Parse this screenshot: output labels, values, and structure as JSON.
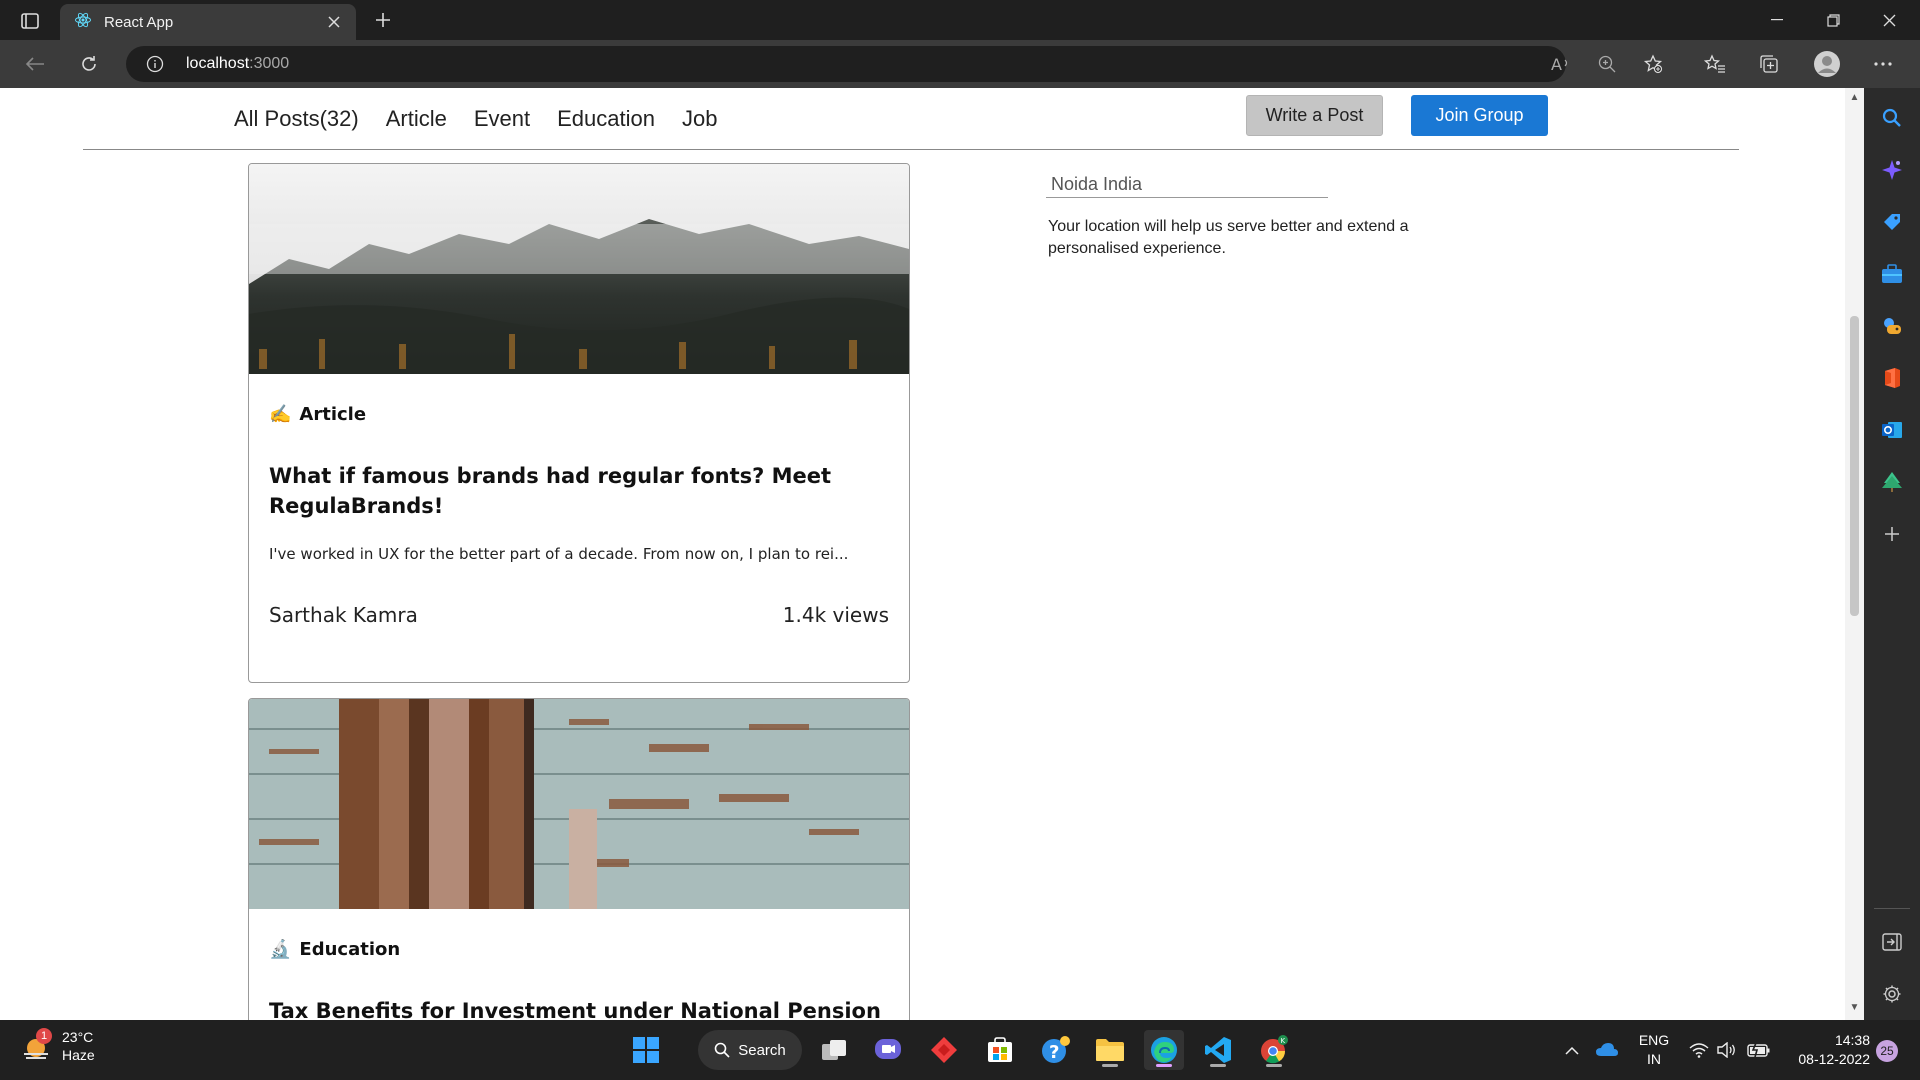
{
  "browser": {
    "tab_title": "React App",
    "url_host": "localhost",
    "url_port": ":3000"
  },
  "nav": {
    "items": [
      "All Posts(32)",
      "Article",
      "Event",
      "Education",
      "Job"
    ],
    "write_post_label": "Write a Post",
    "join_group_label": "Join Group"
  },
  "posts": [
    {
      "category_emoji": "✍️",
      "category": "Article",
      "title": "What if famous brands had regular fonts? Meet RegulaBrands!",
      "excerpt": "I've worked in UX for the better part of a decade. From now on, I plan to rei...",
      "author": "Sarthak Kamra",
      "views": "1.4k views"
    },
    {
      "category_emoji": "🔬",
      "category": "Education",
      "title": "Tax Benefits for Investment under National Pension"
    }
  ],
  "location": {
    "value": "Noida India",
    "note": "Your location will help us serve better and extend a personalised experience."
  },
  "taskbar": {
    "temperature": "23°C",
    "condition": "Haze",
    "weather_badge": "1",
    "search_label": "Search",
    "lang_line1": "ENG",
    "lang_line2": "IN",
    "time": "14:38",
    "date": "08-12-2022",
    "notification_count": "25"
  }
}
